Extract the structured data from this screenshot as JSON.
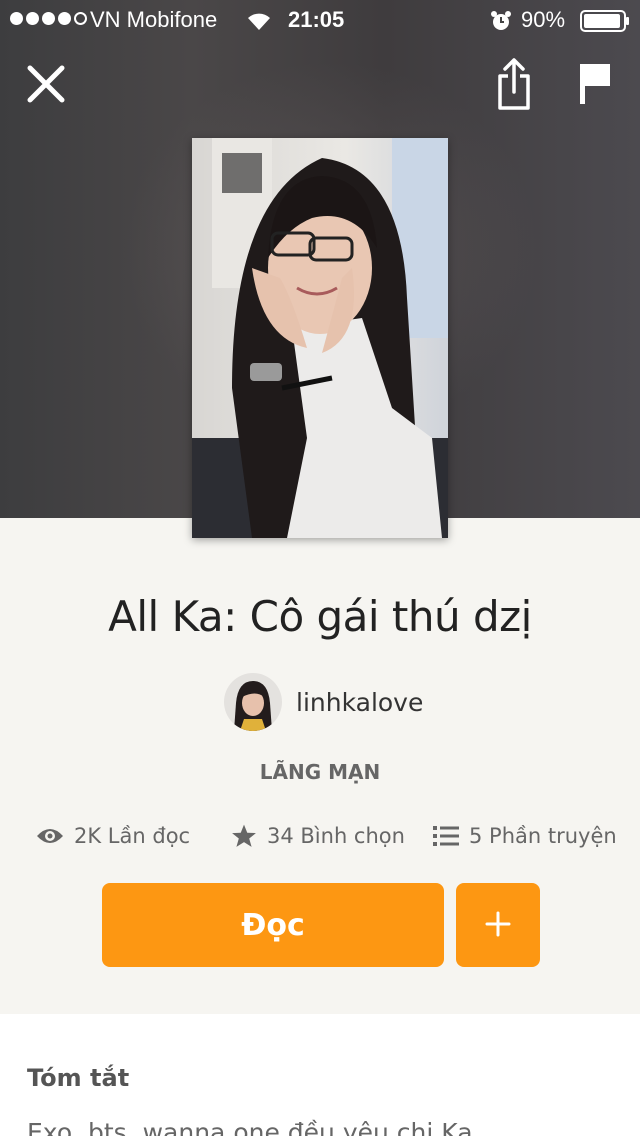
{
  "status_bar": {
    "carrier": "VN Mobifone",
    "time": "21:05",
    "battery": "90%"
  },
  "top_actions": {
    "close_icon": "close-icon",
    "share_icon": "share-icon",
    "flag_icon": "flag-icon"
  },
  "story": {
    "title": "All Ka: Cô gái thú dzị",
    "author": "linhkalove",
    "genre": "LÃNG MẠN"
  },
  "stats": {
    "reads": "2K Lần đọc",
    "votes": "34 Bình chọn",
    "parts": "5 Phần truyện"
  },
  "actions": {
    "read_label": "Đọc",
    "add_label": "+"
  },
  "summary": {
    "heading": "Tóm tắt",
    "text": "Exo, bts, wanna one đều yêu chị Ka"
  },
  "colors": {
    "accent": "#fd9712",
    "background": "#f6f5f1"
  }
}
